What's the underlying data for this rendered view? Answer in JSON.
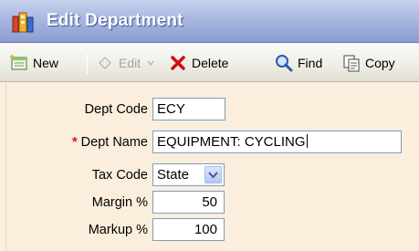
{
  "window": {
    "title": "Edit Department"
  },
  "toolbar": {
    "new_label": "New",
    "edit_label": "Edit",
    "delete_label": "Delete",
    "find_label": "Find",
    "copy_label": "Copy"
  },
  "form": {
    "dept_code": {
      "label": "Dept Code",
      "value": "ECY"
    },
    "dept_name": {
      "label": "Dept Name",
      "required_marker": "*",
      "value": "EQUIPMENT: CYCLING"
    },
    "tax_code": {
      "label": "Tax Code",
      "value": "State"
    },
    "margin": {
      "label": "Margin %",
      "value": "50"
    },
    "markup": {
      "label": "Markup %",
      "value": "100"
    }
  },
  "colors": {
    "title_bar": "#8a9dd2",
    "form_background": "#fbeedd",
    "required_star": "#d8141a",
    "delete_x": "#cc1010"
  },
  "icons": {
    "title": "department-icon",
    "new": "new-document-icon",
    "edit": "edit-icon",
    "delete": "delete-x-icon",
    "find": "magnifier-icon",
    "copy": "copy-icon",
    "dropdown": "chevron-down-icon"
  }
}
